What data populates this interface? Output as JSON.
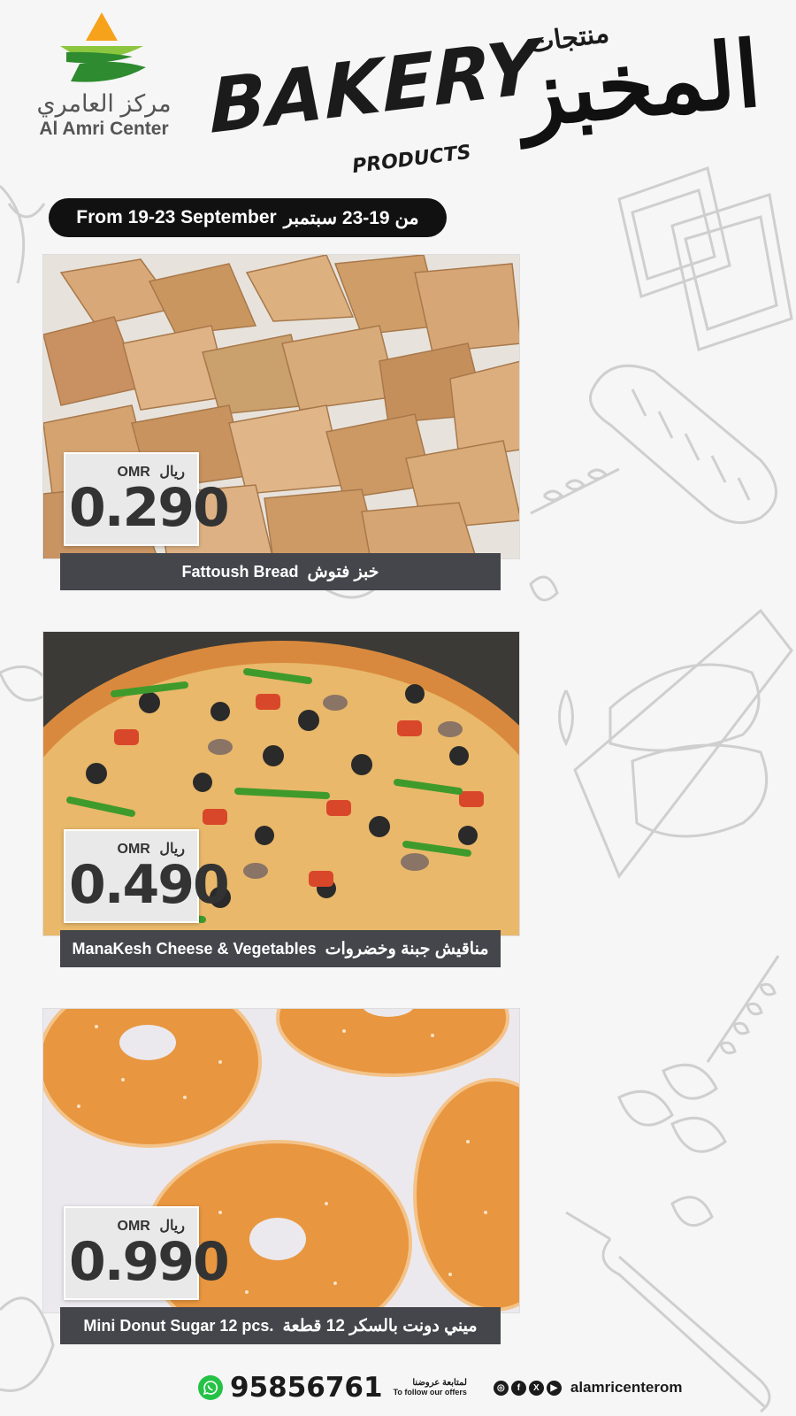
{
  "brand": {
    "name_ar": "مركز العامري",
    "name_en": "Al Amri Center",
    "colors": {
      "orange": "#f7a21b",
      "green": "#2e8b2f",
      "lime": "#8cc63f"
    }
  },
  "heading": {
    "title_en": "BAKERY",
    "subtitle_en": "PRODUCTS",
    "title_ar_small": "منتجات",
    "title_ar_big": "المخبز"
  },
  "offer": {
    "date_en": "From 19-23 September",
    "date_ar": "من 19-23 سبتمبر"
  },
  "products": [
    {
      "name_en": "Fattoush Bread",
      "name_ar": "خبز فتوش",
      "price": "0.290",
      "currency_en": "OMR",
      "currency_ar": "ريال",
      "photo": "fattoush-chips"
    },
    {
      "name_en": "ManaKesh Cheese & Vegetables",
      "name_ar": "مناقيش جبنة وخضروات",
      "price": "0.490",
      "currency_en": "OMR",
      "currency_ar": "ريال",
      "photo": "vegetable-pizza"
    },
    {
      "name_en": "Mini Donut Sugar 12 pcs.",
      "name_ar": "ميني دونت بالسكر 12 قطعة",
      "price": "0.990",
      "currency_en": "OMR",
      "currency_ar": "ريال",
      "photo": "sugar-donuts"
    }
  ],
  "footer": {
    "phone": "95856761",
    "follow_ar": "لمتابعة عروضنا",
    "follow_en": "To follow our offers",
    "handle": "alamricenterom",
    "icons": [
      "whatsapp-icon",
      "instagram-icon",
      "facebook-icon",
      "x-icon",
      "youtube-icon"
    ]
  }
}
